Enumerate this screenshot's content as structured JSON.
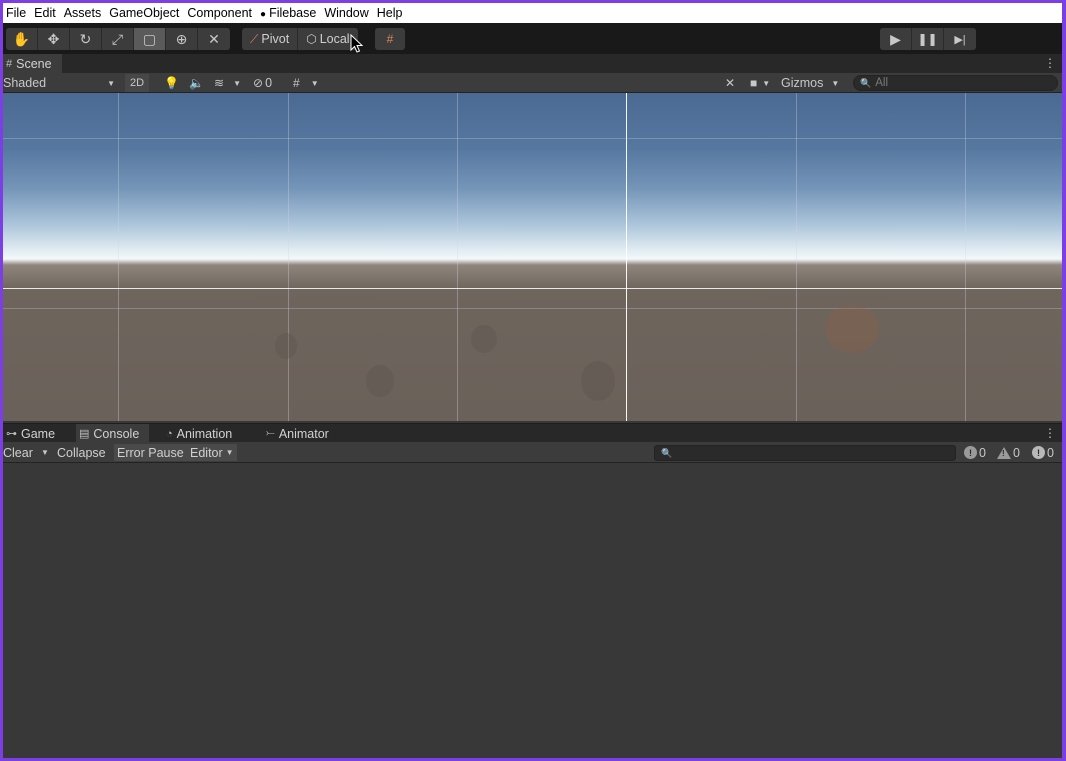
{
  "menubar": {
    "items": [
      "File",
      "Edit",
      "Assets",
      "GameObject",
      "Component",
      "Filebase",
      "Window",
      "Help"
    ]
  },
  "toolbar": {
    "tools": [
      "hand-tool",
      "move-tool",
      "rotate-tool",
      "scale-tool",
      "rect-tool",
      "transform-tool",
      "custom-tool"
    ],
    "active_tool": "rect-tool",
    "pivot_label": "Pivot",
    "local_label": "Local",
    "play_controls": [
      "play",
      "pause",
      "step"
    ]
  },
  "scene_panel": {
    "tab_label": "Scene",
    "draw_mode": "Shaded",
    "mode_2d": "2D",
    "hidden_count": "0",
    "gizmos_label": "Gizmos",
    "search_placeholder": "All"
  },
  "bottom_panel": {
    "tabs": [
      "Game",
      "Console",
      "Animation",
      "Animator"
    ],
    "active_tab": "Console"
  },
  "console": {
    "clear_label": "Clear",
    "collapse_label": "Collapse",
    "error_pause_label": "Error Pause",
    "editor_label": "Editor",
    "log_count": "0",
    "warning_count": "0",
    "error_count": "0"
  },
  "colors": {
    "window_border": "#7b3fe4",
    "panel_bg": "#383838",
    "toolbar_bg": "#191919"
  }
}
